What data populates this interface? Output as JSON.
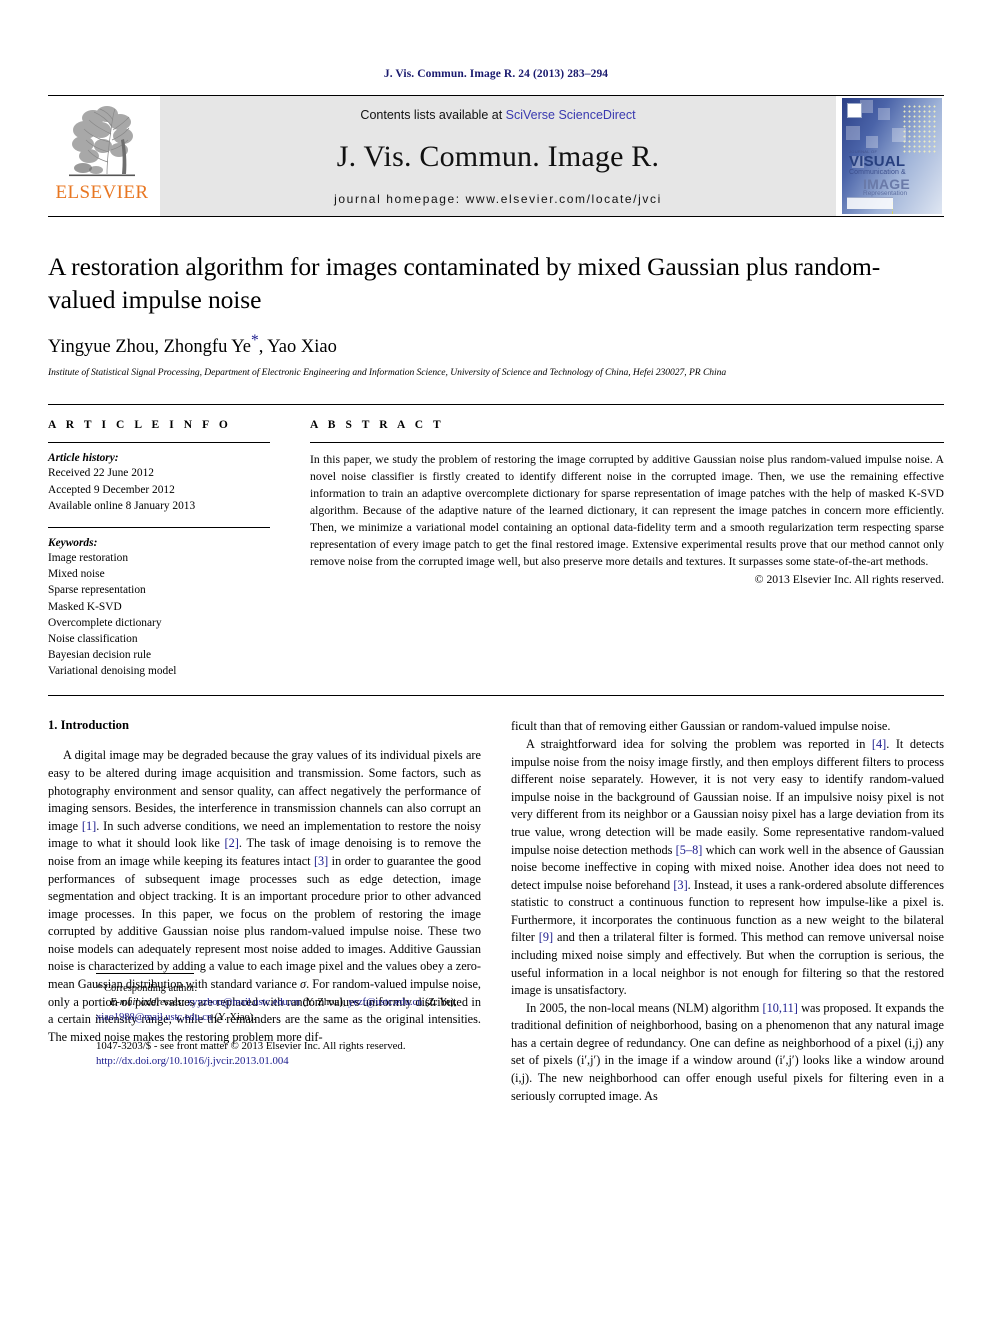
{
  "running_head": "J. Vis. Commun. Image R. 24 (2013) 283–294",
  "masthead": {
    "publisher_wordmark": "ELSEVIER",
    "contents_prefix": "Contents lists available at ",
    "contents_link": "SciVerse ScienceDirect",
    "journal_title": "J. Vis. Commun. Image R.",
    "homepage": "journal homepage: www.elsevier.com/locate/jvci",
    "cover": {
      "line1": "JOURNAL OF",
      "line2": "VISUAL",
      "line3": "Communication &",
      "line4": "IMAGE",
      "line5": "Representation"
    }
  },
  "title": "A restoration algorithm for images contaminated by mixed Gaussian plus random-valued impulse noise",
  "authors": "Yingyue Zhou, Zhongfu Ye",
  "authors_tail": ", Yao Xiao",
  "corresponding_marker": "*",
  "affiliation": "Institute of Statistical Signal Processing, Department of Electronic Engineering and Information Science, University of Science and Technology of China, Hefei 230027, PR China",
  "article_info": {
    "heading": "A R T I C L E   I N F O",
    "history_label": "Article history:",
    "history": [
      "Received 22 June 2012",
      "Accepted 9 December 2012",
      "Available online 8 January 2013"
    ],
    "keywords_label": "Keywords:",
    "keywords": [
      "Image restoration",
      "Mixed noise",
      "Sparse representation",
      "Masked K-SVD",
      "Overcomplete dictionary",
      "Noise classification",
      "Bayesian decision rule",
      "Variational denoising model"
    ]
  },
  "abstract": {
    "heading": "A B S T R A C T",
    "text": "In this paper, we study the problem of restoring the image corrupted by additive Gaussian noise plus random-valued impulse noise. A novel noise classifier is firstly created to identify different noise in the corrupted image. Then, we use the remaining effective information to train an adaptive overcomplete dictionary for sparse representation of image patches with the help of masked K-SVD algorithm. Because of the adaptive nature of the learned dictionary, it can represent the image patches in concern more efficiently. Then, we minimize a variational model containing an optional data-fidelity term and a smooth regularization term respecting sparse representation of every image patch to get the final restored image. Extensive experimental results prove that our method cannot only remove noise from the corrupted image well, but also preserve more details and textures. It surpasses some state-of-the-art methods.",
    "copyright": "© 2013 Elsevier Inc. All rights reserved."
  },
  "body": {
    "section_heading": "1. Introduction",
    "left_p1_a": "A digital image may be degraded because the gray values of its individual pixels are easy to be altered during image acquisition and transmission. Some factors, such as photography environment and sensor quality, can affect negatively the performance of imaging sensors. Besides, the interference in transmission channels can also corrupt an image ",
    "ref1": "[1]",
    "left_p1_b": ". In such adverse conditions, we need an implementation to restore the noisy image to what it should look like ",
    "ref2": "[2]",
    "left_p1_c": ". The task of image denoising is to remove the noise from an image while keeping its features intact ",
    "ref3": "[3]",
    "left_p1_d": " in order to guarantee the good performances of subsequent image processes such as edge detection, image segmentation and object tracking. It is an important procedure prior to other advanced image processes. In this paper, we focus on the problem of restoring the image corrupted by additive Gaussian noise plus random-valued impulse noise. These two noise models can adequately represent most noise added to images. Additive Gaussian noise is characterized by adding a value to each image pixel and the values obey a zero-mean Gaussian distribution with standard variance ",
    "sigma": "σ",
    "left_p1_e": ". For random-valued impulse noise, only a portion of pixel values are replaced with random values uniformly distributed in a certain intensity range, while the remainders are the same as the original intensities. The mixed noise makes the restoring problem more dif-",
    "right_p1_cont": "ficult than that of removing either Gaussian or random-valued impulse noise.",
    "right_p2_a": "A straightforward idea for solving the problem was reported in ",
    "ref4": "[4]",
    "right_p2_b": ". It detects impulse noise from the noisy image firstly, and then employs different filters to process different noise separately. However, it is not very easy to identify random-valued impulse noise in the background of Gaussian noise. If an impulsive noisy pixel is not very different from its neighbor or a Gaussian noisy pixel has a large deviation from its true value, wrong detection will be made easily. Some representative random-valued impulse noise detection methods ",
    "ref58": "[5–8]",
    "right_p2_c": " which can work well in the absence of Gaussian noise become ineffective in coping with mixed noise. Another idea does not need to detect impulse noise beforehand ",
    "ref3b": "[3]",
    "right_p2_d": ". Instead, it uses a rank-ordered absolute differences statistic to construct a continuous function to represent how impulse-like a pixel is. Furthermore, it incorporates the continuous function as a new weight to the bilateral filter ",
    "ref9": "[9]",
    "right_p2_e": " and then a trilateral filter is formed. This method can remove universal noise including mixed noise simply and effectively. But when the corruption is serious, the useful information in a local neighbor is not enough for filtering so that the restored image is unsatisfactory.",
    "right_p3_a": "In 2005, the non-local means (NLM) algorithm ",
    "ref1011": "[10,11]",
    "right_p3_b": " was proposed. It expands the traditional definition of neighborhood, basing on a phenomenon that any natural image has a certain degree of redundancy. One can define as neighborhood of a pixel (i,j) any set of pixels (i′,j′) in the image if a window around (i′,j′) looks like a window around (i,j). The new neighborhood can offer enough useful pixels for filtering even in a seriously corrupted image. As"
  },
  "footnote": {
    "star": "*",
    "corresponding": "Corresponding author.",
    "email_label": "E-mail addresses:",
    "email1": "zyyzhou@mail.ustc.edu.cn",
    "email1_name": " (Y. Zhou), ",
    "email2": "yezf@ustc.edu.cn",
    "email2_name": " (Z. Ye), ",
    "email3": "xiao1988@mail.ustc.edu.cn",
    "email3_name": " (Y. Xiao)."
  },
  "imprint": {
    "issn_line": "1047-3203/$ - see front matter © 2013 Elsevier Inc. All rights reserved.",
    "doi": "http://dx.doi.org/10.1016/j.jvcir.2013.01.004"
  }
}
